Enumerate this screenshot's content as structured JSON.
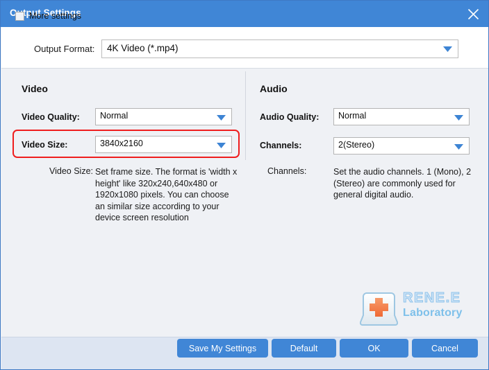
{
  "window": {
    "title": "Output Settings",
    "close_icon": "close-icon",
    "accent_color": "#4086d6",
    "highlight_color": "#ef1d1d"
  },
  "format_row": {
    "label": "Output Format:",
    "value": "4K Video (*.mp4)",
    "caret_icon": "chevron-down-icon"
  },
  "video": {
    "section_title": "Video",
    "quality": {
      "label": "Video Quality:",
      "value": "Normal"
    },
    "size": {
      "label": "Video Size:",
      "value": "3840x2160"
    },
    "description": {
      "label": "Video Size:",
      "text": "Set frame size. The format is 'width x height' like 320x240,640x480 or 1920x1080 pixels. You can choose an similar size according to your device screen resolution"
    }
  },
  "audio": {
    "section_title": "Audio",
    "quality": {
      "label": "Audio Quality:",
      "value": "Normal"
    },
    "channels": {
      "label": "Channels:",
      "value": "2(Stereo)"
    },
    "description": {
      "label": "Channels:",
      "text": "Set the audio channels. 1 (Mono), 2 (Stereo) are commonly used for general digital audio."
    }
  },
  "logo": {
    "mark_icon": "red-cross-keycap-icon",
    "brand": "RENE.E",
    "sub_brand": "Laboratory"
  },
  "footer": {
    "more_settings_label": "More settings",
    "more_settings_checked": false,
    "buttons": {
      "save": "Save My Settings",
      "default": "Default",
      "ok": "OK",
      "cancel": "Cancel"
    }
  }
}
